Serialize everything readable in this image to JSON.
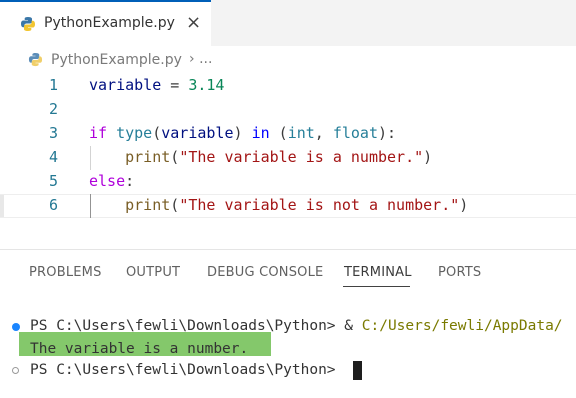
{
  "tab": {
    "title": "PythonExample.py",
    "close_icon": "×",
    "icon": "python-file-icon"
  },
  "breadcrumb": {
    "file": "PythonExample.py",
    "separator": "›",
    "ellipsis": "..."
  },
  "editor": {
    "line_numbers": [
      "1",
      "2",
      "3",
      "4",
      "5",
      "6"
    ],
    "lines": [
      [
        {
          "t": "variable",
          "c": "var"
        },
        {
          "t": " = ",
          "c": "punc"
        },
        {
          "t": "3.14",
          "c": "num"
        }
      ],
      [],
      [
        {
          "t": "if",
          "c": "kw-ctrl"
        },
        {
          "t": " ",
          "c": "punc"
        },
        {
          "t": "type",
          "c": "type"
        },
        {
          "t": "(",
          "c": "punc"
        },
        {
          "t": "variable",
          "c": "var"
        },
        {
          "t": ") ",
          "c": "punc"
        },
        {
          "t": "in",
          "c": "kw"
        },
        {
          "t": " (",
          "c": "punc"
        },
        {
          "t": "int",
          "c": "type"
        },
        {
          "t": ", ",
          "c": "punc"
        },
        {
          "t": "float",
          "c": "type"
        },
        {
          "t": "):",
          "c": "punc"
        }
      ],
      [
        {
          "t": "    ",
          "c": "punc"
        },
        {
          "t": "print",
          "c": "fn"
        },
        {
          "t": "(",
          "c": "punc"
        },
        {
          "t": "\"The variable is a number.\"",
          "c": "str"
        },
        {
          "t": ")",
          "c": "punc"
        }
      ],
      [
        {
          "t": "else",
          "c": "kw-ctrl"
        },
        {
          "t": ":",
          "c": "punc"
        }
      ],
      [
        {
          "t": "    ",
          "c": "punc"
        },
        {
          "t": "print",
          "c": "fn"
        },
        {
          "t": "(",
          "c": "punc"
        },
        {
          "t": "\"The variable is not a number.\"",
          "c": "str"
        },
        {
          "t": ")",
          "c": "punc"
        }
      ]
    ]
  },
  "panel": {
    "tabs": [
      "PROBLEMS",
      "OUTPUT",
      "DEBUG CONSOLE",
      "TERMINAL",
      "PORTS"
    ],
    "active_tab": "TERMINAL"
  },
  "terminal": {
    "line1_prompt": "PS C:\\Users\\fewli\\Downloads\\Python> ",
    "line1_amp": "& ",
    "line1_cmd": "C:/Users/fewli/AppData/",
    "output": "The variable is a number.",
    "line3_prompt": "PS C:\\Users\\fewli\\Downloads\\Python>"
  },
  "colors": {
    "accent": "#005fb8",
    "highlight": "#84c86b"
  }
}
